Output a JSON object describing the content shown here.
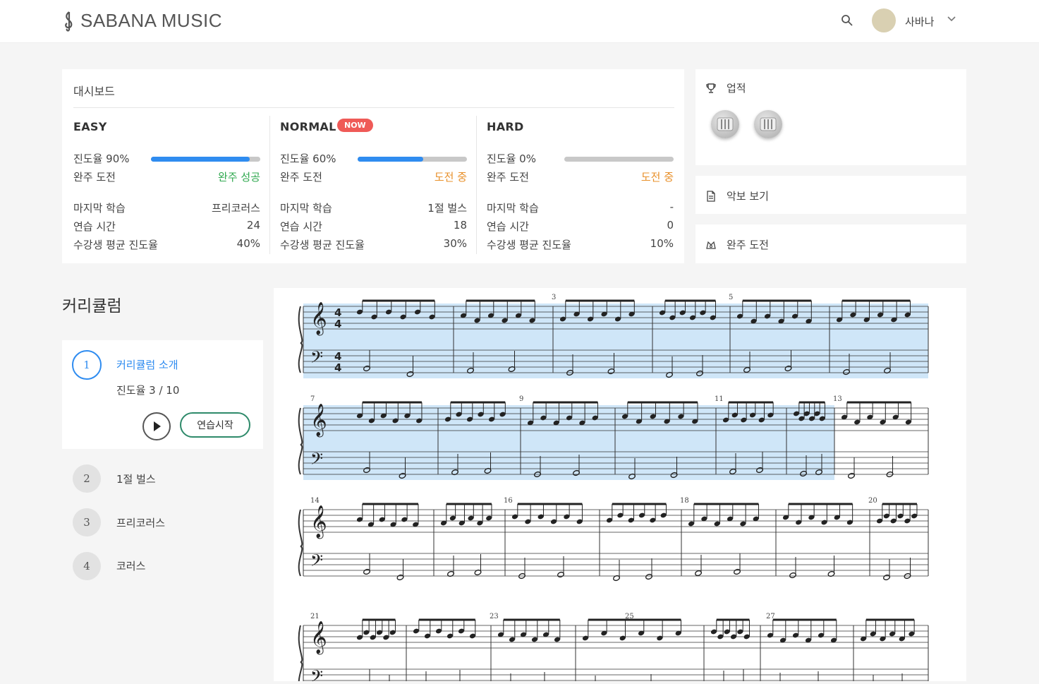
{
  "header": {
    "logo_text": "SABANA MUSIC",
    "logo_icon": "treble-clef-icon",
    "username": "사바나"
  },
  "dashboard": {
    "title": "대시보드",
    "levels": [
      {
        "name": "EASY",
        "progress_label": "진도율 90%",
        "progress": 0.9,
        "challenge_label": "완주 도전",
        "challenge_status": "완주 성공",
        "last_lesson_label": "마지막 학습",
        "last_lesson": "프리코러스",
        "practice_time_label": "연습 시간",
        "practice_time": "24",
        "avg_progress_label": "수강생 평균 진도율",
        "avg_progress": "40%"
      },
      {
        "name": "NORMAL",
        "badge": "NOW",
        "progress_label": "진도율 60%",
        "progress": 0.6,
        "challenge_label": "완주 도전",
        "challenge_status": "도전 중",
        "last_lesson_label": "마지막 학습",
        "last_lesson": "1절 벌스",
        "practice_time_label": "연습 시간",
        "practice_time": "18",
        "avg_progress_label": "수강생 평균 진도율",
        "avg_progress": "30%"
      },
      {
        "name": "HARD",
        "progress_label": "진도율 0%",
        "progress": 0.0,
        "challenge_label": "완주 도전",
        "challenge_status": "도전 중",
        "last_lesson_label": "마지막 학습",
        "last_lesson": "-",
        "practice_time_label": "연습 시간",
        "practice_time": "0",
        "avg_progress_label": "수강생 평균 진도율",
        "avg_progress": "10%"
      }
    ]
  },
  "achievements": {
    "title": "업적",
    "icon": "trophy-icon",
    "badges": [
      "piano-badge-icon",
      "piano-badge-icon"
    ]
  },
  "side_buttons": {
    "sheet_label": "악보 보기",
    "sheet_icon": "document-icon",
    "challenge_label": "완주 도전",
    "challenge_icon": "medal-icon"
  },
  "curriculum": {
    "title": "커리큘럼",
    "items": [
      {
        "number": "1",
        "title": "커리큘럼 소개",
        "progress": "진도율 3 / 10",
        "active": true
      },
      {
        "number": "2",
        "title": "1절 벌스"
      },
      {
        "number": "3",
        "title": "프리코러스"
      },
      {
        "number": "4",
        "title": "코러스"
      }
    ],
    "start_label": "연습시작"
  },
  "score": {
    "measure_numbers": [
      "3",
      "5",
      "7",
      "9",
      "11",
      "13",
      "14",
      "16",
      "18",
      "20",
      "21",
      "23",
      "25",
      "27"
    ],
    "highlight_color": "#cfe6f8"
  }
}
